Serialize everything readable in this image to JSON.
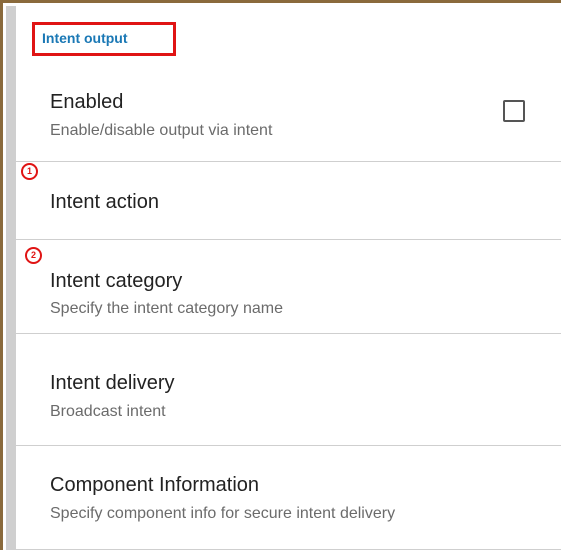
{
  "section": {
    "title": "Intent output"
  },
  "prefs": [
    {
      "title": "Enabled",
      "summary": "Enable/disable output via intent",
      "checked": false
    },
    {
      "title": "Intent action",
      "summary": ""
    },
    {
      "title": "Intent category",
      "summary": "Specify the intent category name"
    },
    {
      "title": "Intent delivery",
      "summary": "Broadcast intent"
    },
    {
      "title": "Component Information",
      "summary": "Specify component info for secure intent delivery"
    }
  ],
  "markers": [
    "1",
    "2"
  ],
  "colors": {
    "highlight": "#e01414",
    "section_title": "#1a78b5",
    "divider": "#cfcfcf",
    "frame": "#8a6a3c"
  }
}
